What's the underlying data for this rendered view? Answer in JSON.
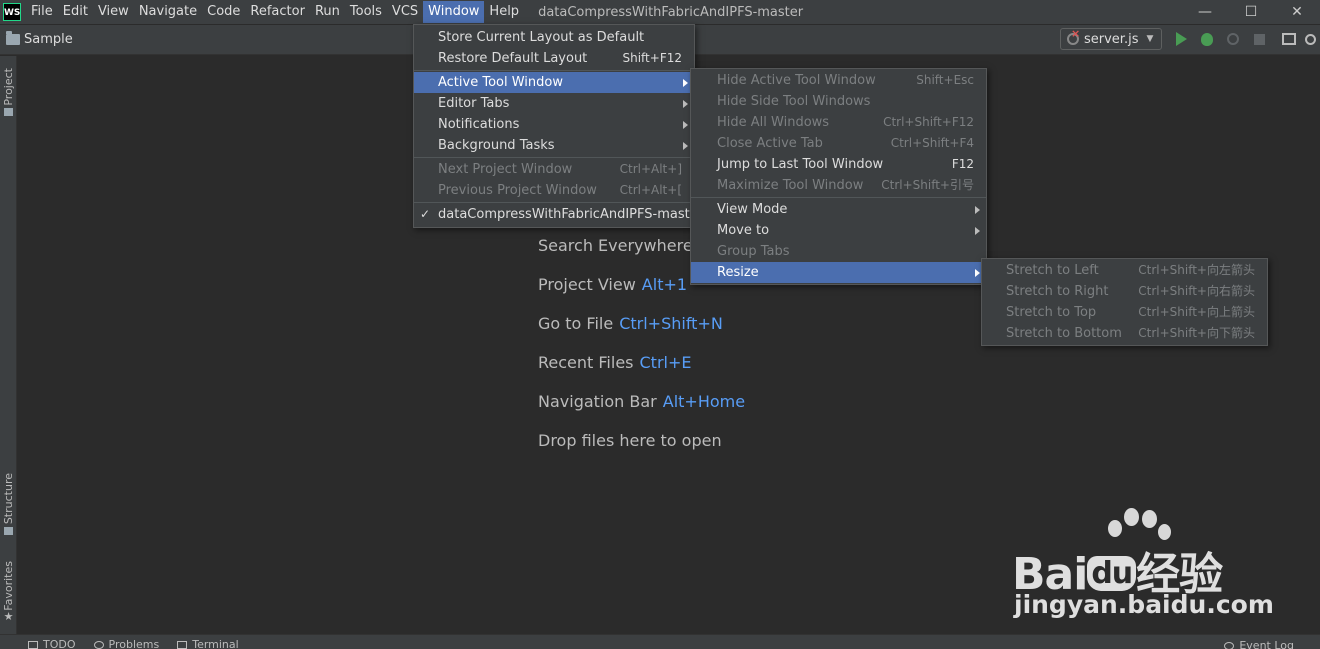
{
  "app": {
    "logo_text": "WS",
    "window_title": "dataCompressWithFabricAndIPFS-master"
  },
  "menubar": {
    "items": [
      {
        "label": "File"
      },
      {
        "label": "Edit"
      },
      {
        "label": "View"
      },
      {
        "label": "Navigate"
      },
      {
        "label": "Code"
      },
      {
        "label": "Refactor"
      },
      {
        "label": "Run"
      },
      {
        "label": "Tools"
      },
      {
        "label": "VCS"
      },
      {
        "label": "Window"
      },
      {
        "label": "Help"
      }
    ]
  },
  "navbar": {
    "project": "Sample",
    "run_config": "server.js"
  },
  "left_strip": {
    "project_tab": "Project",
    "structure_tab": "Structure",
    "favorites_tab": "Favorites"
  },
  "statusbar": {
    "todo": "TODO",
    "problems": "Problems",
    "terminal": "Terminal",
    "event_log": "Event Log"
  },
  "hints": [
    {
      "label": "Search Everywhere",
      "shortcut": ""
    },
    {
      "label": "Project View",
      "shortcut": "Alt+1"
    },
    {
      "label": "Go to File",
      "shortcut": "Ctrl+Shift+N"
    },
    {
      "label": "Recent Files",
      "shortcut": "Ctrl+E"
    },
    {
      "label": "Navigation Bar",
      "shortcut": "Alt+Home"
    },
    {
      "label": "Drop files here to open",
      "shortcut": ""
    }
  ],
  "window_menu": {
    "store_layout": {
      "label": "Store Current Layout as Default",
      "shortcut": ""
    },
    "restore_layout": {
      "label": "Restore Default Layout",
      "shortcut": "Shift+F12"
    },
    "active_tool_window": {
      "label": "Active Tool Window"
    },
    "editor_tabs": {
      "label": "Editor Tabs"
    },
    "notifications": {
      "label": "Notifications"
    },
    "background_tasks": {
      "label": "Background Tasks"
    },
    "next_project": {
      "label": "Next Project Window",
      "shortcut": "Ctrl+Alt+]"
    },
    "previous_project": {
      "label": "Previous Project Window",
      "shortcut": "Ctrl+Alt+["
    },
    "current_project": {
      "label": "dataCompressWithFabricAndIPFS-master",
      "check": "✓"
    }
  },
  "active_tool_window_menu": {
    "hide_active": {
      "label": "Hide Active Tool Window",
      "shortcut": "Shift+Esc"
    },
    "hide_side": {
      "label": "Hide Side Tool Windows",
      "shortcut": ""
    },
    "hide_all": {
      "label": "Hide All Windows",
      "shortcut": "Ctrl+Shift+F12"
    },
    "close_tab": {
      "label": "Close Active Tab",
      "shortcut": "Ctrl+Shift+F4"
    },
    "jump_last": {
      "label": "Jump to Last Tool Window",
      "shortcut": "F12"
    },
    "maximize": {
      "label": "Maximize Tool Window",
      "shortcut": "Ctrl+Shift+引号"
    },
    "view_mode": {
      "label": "View Mode"
    },
    "move_to": {
      "label": "Move to"
    },
    "group_tabs": {
      "label": "Group Tabs"
    },
    "resize": {
      "label": "Resize"
    }
  },
  "resize_menu": {
    "stretch_left": {
      "label": "Stretch to Left",
      "shortcut": "Ctrl+Shift+向左箭头"
    },
    "stretch_right": {
      "label": "Stretch to Right",
      "shortcut": "Ctrl+Shift+向右箭头"
    },
    "stretch_top": {
      "label": "Stretch to Top",
      "shortcut": "Ctrl+Shift+向上箭头"
    },
    "stretch_bottom": {
      "label": "Stretch to Bottom",
      "shortcut": "Ctrl+Shift+向下箭头"
    }
  },
  "watermark": {
    "brand_a": "Bai",
    "brand_b": "du",
    "brand_c": "经验",
    "url": "jingyan.baidu.com"
  },
  "colors": {
    "background": "#2b2b2b",
    "panel": "#3c3f41",
    "selection": "#4b6eaf",
    "shortcut_blue": "#589df6",
    "run_green": "#499c54"
  }
}
